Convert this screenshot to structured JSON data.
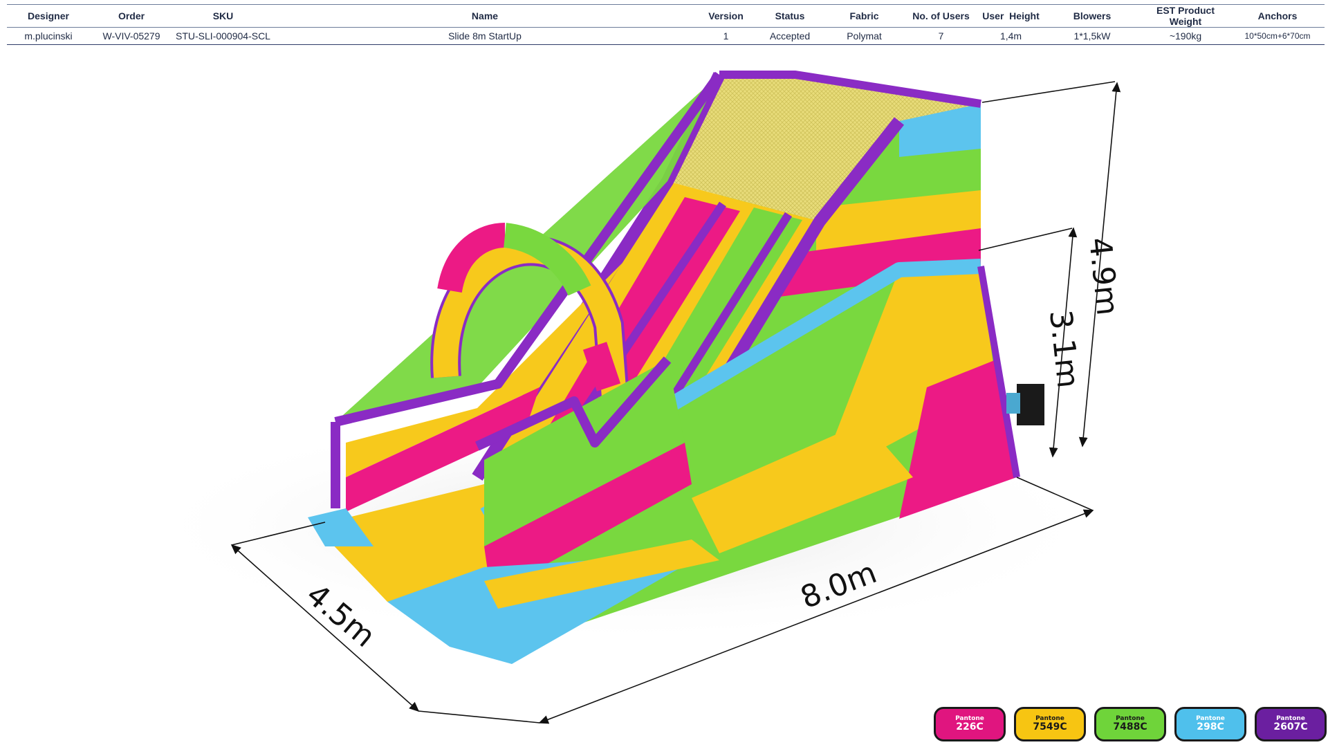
{
  "spec_table": {
    "headers": [
      "Designer",
      "Order",
      "SKU",
      "Name",
      "Version",
      "Status",
      "Fabric",
      "No. of Users",
      "User  Height",
      "Blowers",
      "EST Product Weight",
      "Anchors"
    ],
    "row": [
      "m.plucinski",
      "W-VIV-05279",
      "STU-SLI-000904-SCL",
      "Slide 8m StartUp",
      "1",
      "Accepted",
      "Polymat",
      "7",
      "1,4m",
      "1*1,5kW",
      "~190kg",
      "10*50cm+6*70cm"
    ]
  },
  "dimensions": {
    "height_total": "4.9m",
    "height_platform": "3.1m",
    "length": "8.0m",
    "width": "4.5m"
  },
  "swatches": [
    {
      "brand": "Pantone",
      "code": "226C",
      "color": "#e0157f",
      "text": "#ffffff"
    },
    {
      "brand": "Pantone",
      "code": "7549C",
      "color": "#f7c512",
      "text": "#1a1a1a"
    },
    {
      "brand": "Pantone",
      "code": "7488C",
      "color": "#6fd43a",
      "text": "#1a1a1a"
    },
    {
      "brand": "Pantone",
      "code": "298C",
      "color": "#4fc0ec",
      "text": "#ffffff"
    },
    {
      "brand": "Pantone",
      "code": "2607C",
      "color": "#6b1fa0",
      "text": "#ffffff"
    }
  ],
  "colors": {
    "magenta": "#ec1a85",
    "yellow": "#f7c91c",
    "green": "#79d83f",
    "blue": "#5cc4ee",
    "purple": "#8a2bc4",
    "net": "#e3d25a"
  }
}
